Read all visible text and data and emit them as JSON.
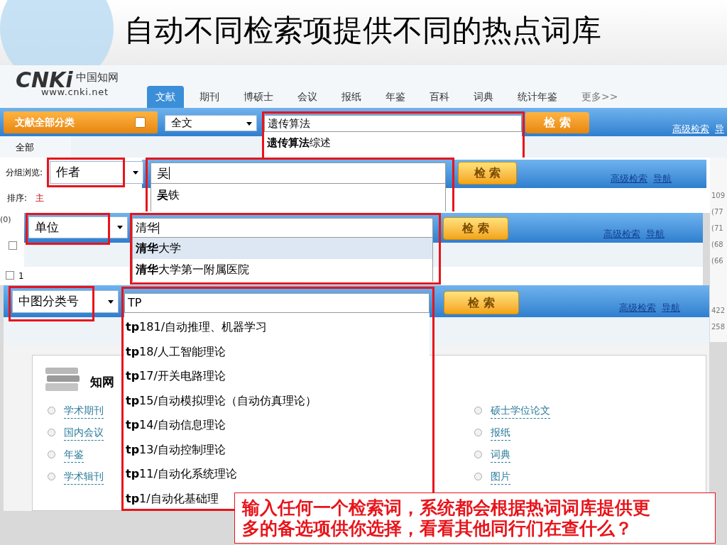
{
  "title": "自动不同检索项提供不同的热点词库",
  "cnki": {
    "logo_mark": "CNKi",
    "logo_text": "中国知网",
    "logo_url": "www.cnki.net",
    "tabs": [
      {
        "label": "文献",
        "selected": true
      },
      {
        "label": "期刊",
        "selected": false
      },
      {
        "label": "博硕士",
        "selected": false
      },
      {
        "label": "会议",
        "selected": false
      },
      {
        "label": "报纸",
        "selected": false
      },
      {
        "label": "年鉴",
        "selected": false
      },
      {
        "label": "百科",
        "selected": false
      },
      {
        "label": "词典",
        "selected": false
      },
      {
        "label": "统计年鉴",
        "selected": false
      },
      {
        "label": "更多>>",
        "selected": false
      }
    ],
    "category_button": "文献全部分类",
    "field_select": "全文",
    "query": "遗传算法",
    "suggestions": [
      "**遗传算法**综述"
    ],
    "search_button": "检 索",
    "links": [
      "高级检索",
      "导"
    ],
    "subnav": "全部"
  },
  "author_panel": {
    "group_label": "分组浏览:",
    "sort_label": "排序:",
    "sort_value": "主",
    "field_select": "作者",
    "query": "吴",
    "suggestions": [
      "**吴**铁"
    ],
    "search_button": "检 索",
    "links": [
      "高级检索",
      "导航"
    ]
  },
  "left_strip": {
    "count": "(0)",
    "row_number": "1",
    "checkboxes": [
      {
        "checked": false
      },
      {
        "checked": false
      }
    ]
  },
  "side_counts": [
    "109",
    "(77",
    "(71",
    "(68",
    "(66",
    "422",
    "258"
  ],
  "unit_panel": {
    "field_select": "单位",
    "query": "清华",
    "suggestions": [
      {
        "text": "**清华**大学",
        "selected": true
      },
      {
        "text": "**清华**大学第一附属医院",
        "selected": false
      }
    ],
    "search_button": "检 索",
    "links": [
      "高级检索",
      "导航"
    ]
  },
  "class_panel": {
    "field_select": "中图分类号",
    "query": "TP",
    "suggestions": [
      "**tp**181/自动推理、机器学习",
      "**tp**18/人工智能理论",
      "**tp**17/开关电路理论",
      "**tp**15/自动模拟理论（自动仿真理论）",
      "**tp**14/自动信息理论",
      "**tp**13/自动控制理论",
      "**tp**11/自动化系统理论",
      "**tp**1/自动化基础理"
    ],
    "search_button": "检 索",
    "links": [
      "高级检索",
      "导航"
    ],
    "portal_title": "知网",
    "portal_left": [
      "学术期刊",
      "国内会议",
      "年鉴",
      "学术辑刊"
    ],
    "portal_right": [
      "硕士学位论文",
      "报纸",
      "词典",
      "图片"
    ]
  },
  "callout": "输入任何一个检索词，系统都会根据热词词库提供更多的备选项供你选择，看看其他同行们在查什么？"
}
